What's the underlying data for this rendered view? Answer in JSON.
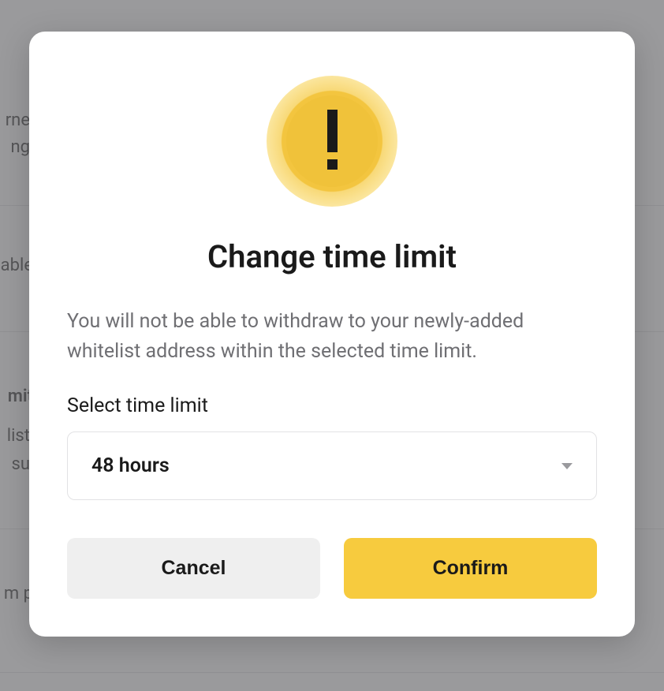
{
  "background": {
    "line1a": "rne",
    "line1b": "ng",
    "line2": "able",
    "line3a": "mit",
    "line3b": "list",
    "line3c": "su",
    "line4": "m p"
  },
  "modal": {
    "title": "Change time limit",
    "description": "You will not be able to withdraw to your newly-added whitelist address within the selected time limit.",
    "select_label": "Select time limit",
    "select_value": "48 hours",
    "cancel_label": "Cancel",
    "confirm_label": "Confirm"
  }
}
